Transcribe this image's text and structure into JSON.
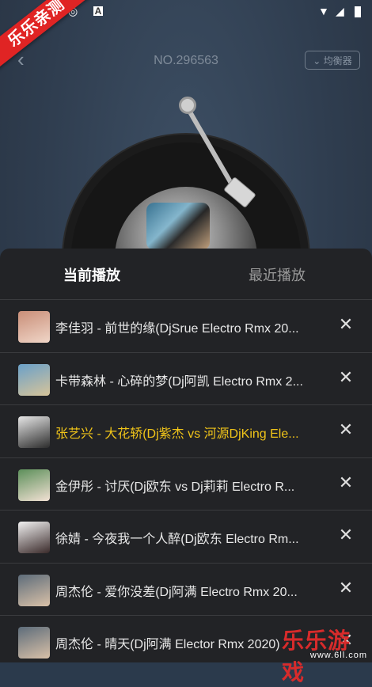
{
  "status_bar": {
    "icons": [
      "cd-icon",
      "app-a-icon",
      "wifi-icon",
      "signal-icon",
      "battery-icon"
    ]
  },
  "ribbon": {
    "text": "乐乐亲测"
  },
  "header": {
    "track_no": "NO.296563",
    "eq_label": "均衡器"
  },
  "tabs": {
    "current": "当前播放",
    "recent": "最近播放"
  },
  "playlist": [
    {
      "title": "李佳羽 - 前世的缘(DjSrue Electro Rmx 20...",
      "thumb_colors": [
        "#c98e78",
        "#f0d6c8"
      ],
      "current": false
    },
    {
      "title": "卡带森林 - 心碎的梦(Dj阿凯 Electro Rmx 2...",
      "thumb_colors": [
        "#6aa0c9",
        "#d7c49a"
      ],
      "current": false
    },
    {
      "title": "张艺兴 - 大花轿(Dj紫杰 vs 河源DjKing Ele...",
      "thumb_colors": [
        "#e6e6e6",
        "#2c2c2c"
      ],
      "current": true
    },
    {
      "title": "金伊彤 - 讨厌(Dj欧东 vs Dj莉莉 Electro R...",
      "thumb_colors": [
        "#5c8f5a",
        "#f2e1d4"
      ],
      "current": false
    },
    {
      "title": "徐婧 - 今夜我一个人醉(Dj欧东 Electro Rm...",
      "thumb_colors": [
        "#f2f2f2",
        "#3a2a2a"
      ],
      "current": false
    },
    {
      "title": "周杰伦 - 爱你没差(Dj阿满 Electro Rmx 20...",
      "thumb_colors": [
        "#5d6c7a",
        "#d9c1a8"
      ],
      "current": false
    },
    {
      "title": "周杰伦 - 晴天(Dj阿满 Elector Rmx 2020)",
      "thumb_colors": [
        "#5d6c7a",
        "#d9c1a8"
      ],
      "current": false
    }
  ],
  "watermark": {
    "brand": "乐乐游戏",
    "url": "www.6ll.com"
  },
  "colors": {
    "current_track": "#f0c419",
    "ribbon": "#e02424"
  }
}
